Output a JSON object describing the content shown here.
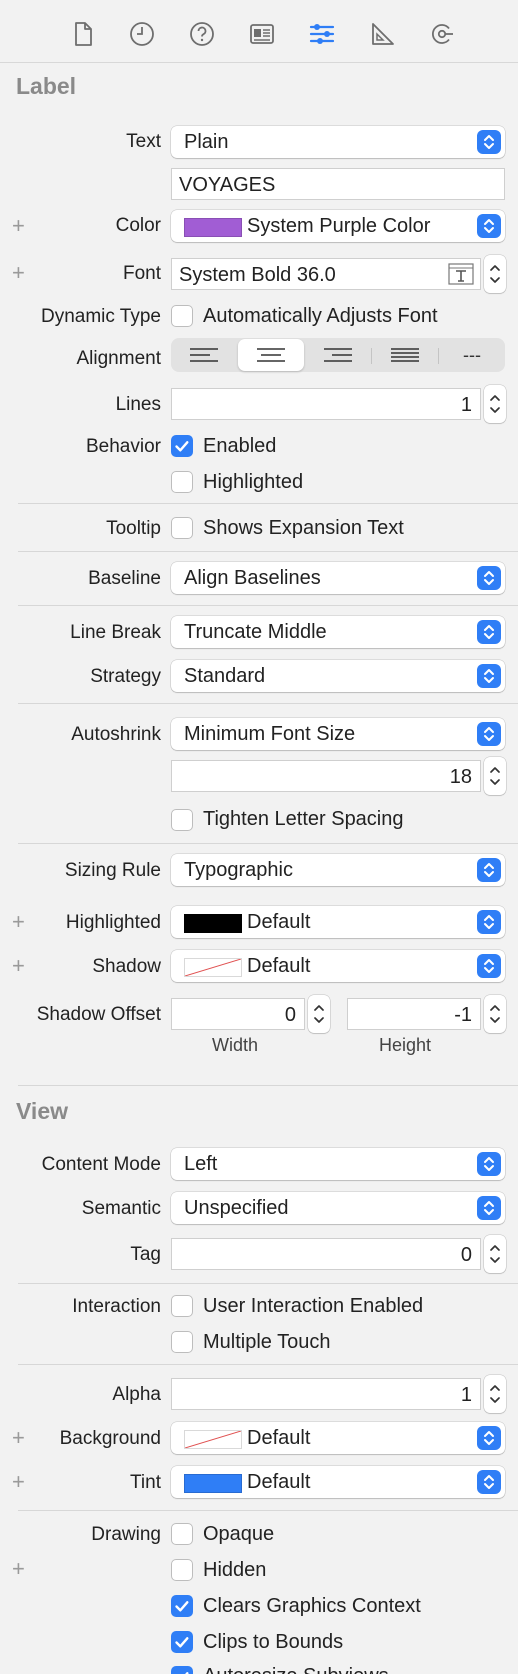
{
  "toolbar": {
    "icons": [
      "file-icon",
      "clock-icon",
      "help-icon",
      "identity-icon",
      "attributes-icon",
      "ruler-icon",
      "connections-icon"
    ]
  },
  "colors": {
    "accent": "#2f7ef6",
    "system_purple": "#a15dd4",
    "tint_blue": "#2f7ef6",
    "black": "#000000"
  },
  "label_section": {
    "title": "Label",
    "text": {
      "label": "Text",
      "value": "Plain",
      "content": "VOYAGES"
    },
    "color": {
      "label": "Color",
      "value": "System Purple Color"
    },
    "font": {
      "label": "Font",
      "value": "System Bold 36.0"
    },
    "dynamic_type": {
      "label": "Dynamic Type",
      "option": "Automatically Adjusts Font",
      "checked": false
    },
    "alignment": {
      "label": "Alignment",
      "options": [
        "left",
        "center",
        "right",
        "justified",
        "natural"
      ],
      "selected": "center",
      "natural_glyph": "---"
    },
    "lines": {
      "label": "Lines",
      "value": "1"
    },
    "behavior": {
      "label": "Behavior",
      "enabled": {
        "text": "Enabled",
        "checked": true
      },
      "highlighted": {
        "text": "Highlighted",
        "checked": false
      }
    },
    "tooltip": {
      "label": "Tooltip",
      "option": "Shows Expansion Text",
      "checked": false
    },
    "baseline": {
      "label": "Baseline",
      "value": "Align Baselines"
    },
    "line_break": {
      "label": "Line Break",
      "value": "Truncate Middle"
    },
    "strategy": {
      "label": "Strategy",
      "value": "Standard"
    },
    "autoshrink": {
      "label": "Autoshrink",
      "value": "Minimum Font Size",
      "min_size": "18",
      "tighten": {
        "text": "Tighten Letter Spacing",
        "checked": false
      }
    },
    "sizing_rule": {
      "label": "Sizing Rule",
      "value": "Typographic"
    },
    "highlighted_color": {
      "label": "Highlighted",
      "value": "Default"
    },
    "shadow": {
      "label": "Shadow",
      "value": "Default"
    },
    "shadow_offset": {
      "label": "Shadow Offset",
      "width": "0",
      "height": "-1",
      "width_label": "Width",
      "height_label": "Height"
    }
  },
  "view_section": {
    "title": "View",
    "content_mode": {
      "label": "Content Mode",
      "value": "Left"
    },
    "semantic": {
      "label": "Semantic",
      "value": "Unspecified"
    },
    "tag": {
      "label": "Tag",
      "value": "0"
    },
    "interaction": {
      "label": "Interaction",
      "user_interaction": {
        "text": "User Interaction Enabled",
        "checked": false
      },
      "multiple_touch": {
        "text": "Multiple Touch",
        "checked": false
      }
    },
    "alpha": {
      "label": "Alpha",
      "value": "1"
    },
    "background": {
      "label": "Background",
      "value": "Default"
    },
    "tint": {
      "label": "Tint",
      "value": "Default"
    },
    "drawing": {
      "label": "Drawing",
      "opaque": {
        "text": "Opaque",
        "checked": false
      },
      "hidden": {
        "text": "Hidden",
        "checked": false
      },
      "clears": {
        "text": "Clears Graphics Context",
        "checked": true
      },
      "clips": {
        "text": "Clips to Bounds",
        "checked": true
      },
      "autoresize": {
        "text": "Autoresize Subviews",
        "checked": true
      }
    }
  }
}
